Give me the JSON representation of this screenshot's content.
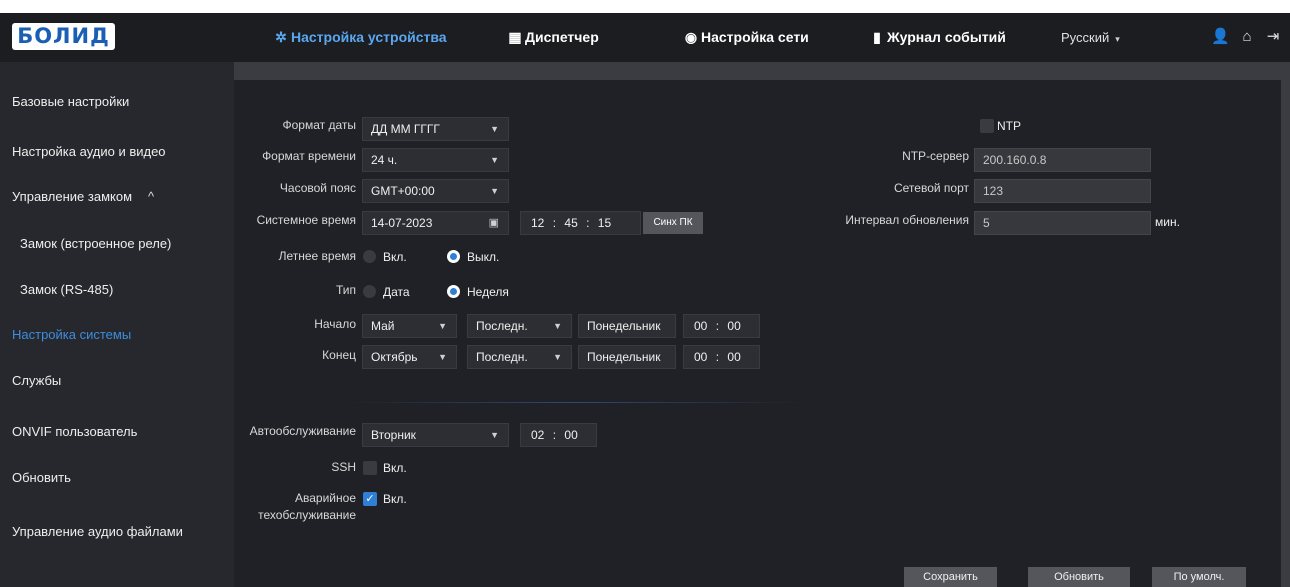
{
  "header": {
    "logo": "БОЛИД",
    "nav": [
      {
        "label": "Настройка устройства",
        "icon": "gear-icon"
      },
      {
        "label": "Диспетчер",
        "icon": "grid-icon"
      },
      {
        "label": "Настройка сети",
        "icon": "globe-icon"
      },
      {
        "label": "Журнал событий",
        "icon": "log-icon"
      }
    ],
    "language": "Русский",
    "icons": [
      "user-icon",
      "home-icon",
      "logout-icon"
    ]
  },
  "sidebar": {
    "items": [
      {
        "label": "Базовые настройки"
      },
      {
        "label": "Настройка аудио и видео"
      },
      {
        "label": "Управление замком"
      },
      {
        "label": "Замок (встроенное реле)"
      },
      {
        "label": "Замок (RS-485)"
      },
      {
        "label": "Настройка системы"
      },
      {
        "label": "Службы"
      },
      {
        "label": "ONVIF пользователь"
      },
      {
        "label": "Обновить"
      },
      {
        "label": "Управление аудио файлами"
      }
    ],
    "active": "Настройка системы",
    "expanded_chevron": "^"
  },
  "form": {
    "date_format": {
      "label": "Формат даты",
      "value": "ДД ММ ГГГГ"
    },
    "time_format": {
      "label": "Формат времени",
      "value": "24 ч."
    },
    "timezone": {
      "label": "Часовой пояс",
      "value": "GMT+00:00"
    },
    "system_time": {
      "label": "Системное время",
      "date": "14-07-2023",
      "hh": "12",
      "mm": "45",
      "ss": "15",
      "sync_button": "Синх ПК"
    },
    "dst": {
      "label": "Летнее время",
      "on": "Вкл.",
      "off": "Выкл.",
      "selected": "off"
    },
    "type": {
      "label": "Тип",
      "date": "Дата",
      "week": "Неделя",
      "selected": "week"
    },
    "start": {
      "label": "Начало",
      "month": "Май",
      "week": "Последн.",
      "day": "Понедельник",
      "hh": "00",
      "mm": "00"
    },
    "end": {
      "label": "Конец",
      "month": "Октябрь",
      "week": "Последн.",
      "day": "Понедельник",
      "hh": "00",
      "mm": "00"
    },
    "auto_maintenance": {
      "label": "Автообслуживание",
      "day": "Вторник",
      "hh": "02",
      "mm": "00"
    },
    "ssh": {
      "label": "SSH",
      "option": "Вкл.",
      "checked": false
    },
    "emergency": {
      "label_line1": "Аварийное",
      "label_line2": "техобслуживание",
      "option": "Вкл.",
      "checked": true
    },
    "ntp": {
      "label": "NTP",
      "server_label": "NTP-сервер",
      "server": "200.160.0.8",
      "port_label": "Сетевой порт",
      "port": "123",
      "interval_label": "Интервал обновления",
      "interval": "5",
      "unit": "мин."
    },
    "separator": ":"
  },
  "buttons": {
    "save": "Сохранить",
    "refresh": "Обновить",
    "default": "По умолч."
  },
  "colors": {
    "accent": "#2f7fd6",
    "active_nav": "#5aa7f0",
    "topbar": "#1c1d21",
    "panel": "#202126"
  }
}
